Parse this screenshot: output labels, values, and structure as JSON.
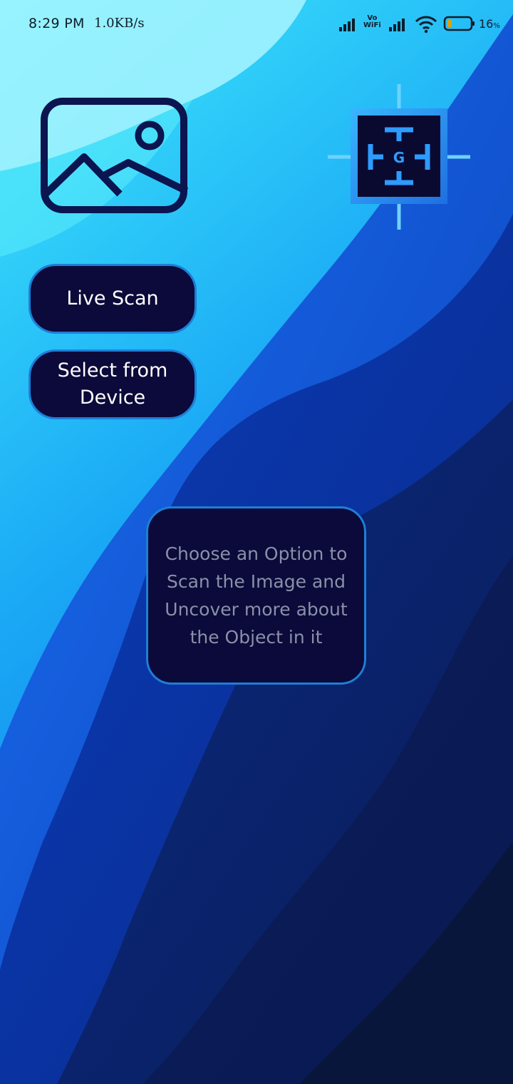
{
  "status_bar": {
    "time": "8:29 PM",
    "network_speed": "1.0KB/s",
    "vowifi_label_top": "Vo",
    "vowifi_label_bottom": "WiFi",
    "battery_percent": "16",
    "battery_level": 0.16,
    "icons": [
      "signal-icon",
      "vowifi-icon",
      "signal-icon",
      "wifi-icon",
      "battery-icon"
    ]
  },
  "main": {
    "gallery_icon": "image-gallery-icon",
    "logo_icon": "scanner-logo-icon",
    "logo_letter": "G",
    "live_scan_label": "Live Scan",
    "select_from_device_label": "Select from Device",
    "info_message": "Choose an Option to Scan the Image and Uncover more about the Object in it"
  },
  "colors": {
    "button_fill": "#0b0a3a",
    "button_border": "#1f7ed6",
    "button_text": "#ffffff",
    "info_text": "#8a90a8",
    "background_light": "#29e0f8",
    "background_dark": "#0a1840"
  }
}
